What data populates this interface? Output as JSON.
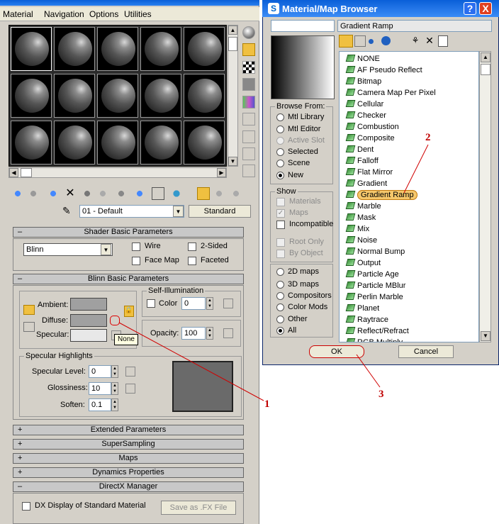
{
  "editor": {
    "menu": [
      "Material",
      "Navigation",
      "Options",
      "Utilities"
    ],
    "material_name": "01 - Default",
    "material_type": "Standard",
    "rollouts": {
      "shader_basic": "Shader Basic Parameters",
      "blinn_basic": "Blinn Basic Parameters",
      "extended": "Extended Parameters",
      "supersampling": "SuperSampling",
      "maps": "Maps",
      "dynamics": "Dynamics Properties",
      "directx": "DirectX Manager"
    },
    "shader": {
      "type": "Blinn",
      "wire": "Wire",
      "two_sided": "2-Sided",
      "face_map": "Face Map",
      "faceted": "Faceted"
    },
    "blinn": {
      "ambient": "Ambient:",
      "diffuse": "Diffuse:",
      "specular": "Specular:",
      "self_illum": "Self-Illumination",
      "color": "Color",
      "color_value": "0",
      "opacity": "Opacity:",
      "opacity_value": "100",
      "tooltip": "None"
    },
    "highlights": {
      "title": "Specular Highlights",
      "level_label": "Specular Level:",
      "level_value": "0",
      "gloss_label": "Glossiness:",
      "gloss_value": "10",
      "soften_label": "Soften:",
      "soften_value": "0.1"
    },
    "directx": {
      "dx_display": "DX Display of Standard Material",
      "save_fx": "Save as .FX File"
    },
    "colors": {
      "ambient": "#a0a0a0",
      "diffuse": "#a0a0a0",
      "specular": "#e8e8e8",
      "highlight_graph": "#6a6a6a"
    }
  },
  "browser": {
    "title": "Material/Map Browser",
    "help": "?",
    "close": "X",
    "name_field": "Gradient Ramp",
    "browse_from": {
      "title": "Browse From:",
      "options": [
        "Mtl Library",
        "Mtl Editor",
        "Active Slot",
        "Selected",
        "Scene",
        "New"
      ],
      "selected": "New"
    },
    "show": {
      "title": "Show",
      "options": [
        "Materials",
        "Maps",
        "Incompatible"
      ],
      "root_only": "Root Only",
      "by_object": "By Object"
    },
    "map_types": {
      "options": [
        "2D maps",
        "3D maps",
        "Compositors",
        "Color Mods",
        "Other",
        "All"
      ],
      "selected": "All"
    },
    "items": [
      "NONE",
      "AF Pseudo Reflect",
      "Bitmap",
      "Camera Map Per Pixel",
      "Cellular",
      "Checker",
      "Combustion",
      "Composite",
      "Dent",
      "Falloff",
      "Flat Mirror",
      "Gradient",
      "Gradient Ramp",
      "Marble",
      "Mask",
      "Mix",
      "Noise",
      "Normal Bump",
      "Output",
      "Particle Age",
      "Particle MBlur",
      "Perlin Marble",
      "Planet",
      "Raytrace",
      "Reflect/Refract",
      "RGB Multiply"
    ],
    "selected_item": "Gradient Ramp",
    "ok": "OK",
    "cancel": "Cancel"
  },
  "annotations": {
    "a1": "1",
    "a2": "2",
    "a3": "3"
  }
}
